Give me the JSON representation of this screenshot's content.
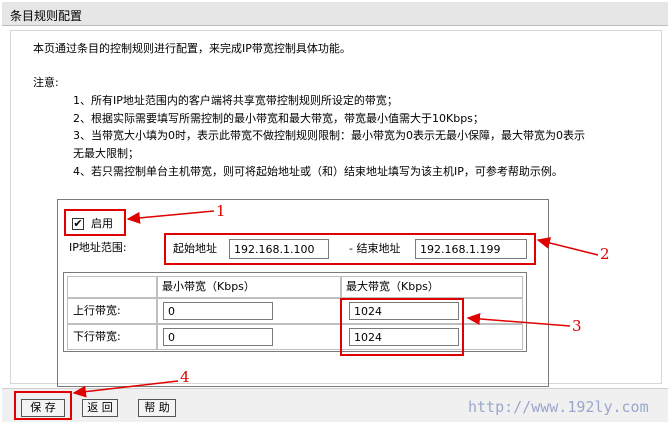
{
  "header": {
    "title": "条目规则配置"
  },
  "intro": "本页通过条目的控制规则进行配置，来完成IP带宽控制具体功能。",
  "notes": {
    "label": "注意:",
    "items": [
      "1、所有IP地址范围内的客户端将共享宽带控制规则所设定的带宽；",
      "2、根据实际需要填写所需控制的最小带宽和最大带宽，带宽最小值需大于10Kbps；",
      "3、当带宽大小填为0时，表示此带宽不做控制规则限制：最小带宽为0表示无最小保障，最大带宽为0表示",
      "无最大限制；",
      "4、若只需控制单台主机带宽，则可将起始地址或（和）结束地址填写为该主机IP，可参考帮助示例。"
    ]
  },
  "form": {
    "enable_label": "启用",
    "enabled": true,
    "ip_range_label": "IP地址范围:",
    "start_label": "起始地址",
    "start_ip": "192.168.1.100",
    "end_label": "- 结束地址",
    "end_ip": "192.168.1.199"
  },
  "bandwidth_table": {
    "columns": [
      "最小带宽（Kbps）",
      "最大带宽（Kbps）"
    ],
    "rows": [
      {
        "label": "上行带宽:",
        "min": "0",
        "max": "1024"
      },
      {
        "label": "下行带宽:",
        "min": "0",
        "max": "1024"
      }
    ]
  },
  "buttons": {
    "save": "保 存",
    "back": "返 回",
    "help": "帮 助"
  },
  "annotations": [
    "1",
    "2",
    "3",
    "4"
  ],
  "watermark": "http://www.192ly.com",
  "colors": {
    "annotation": "#e00000",
    "titlebar": "#e6e6e6",
    "watermark": "#9aa7cc"
  }
}
